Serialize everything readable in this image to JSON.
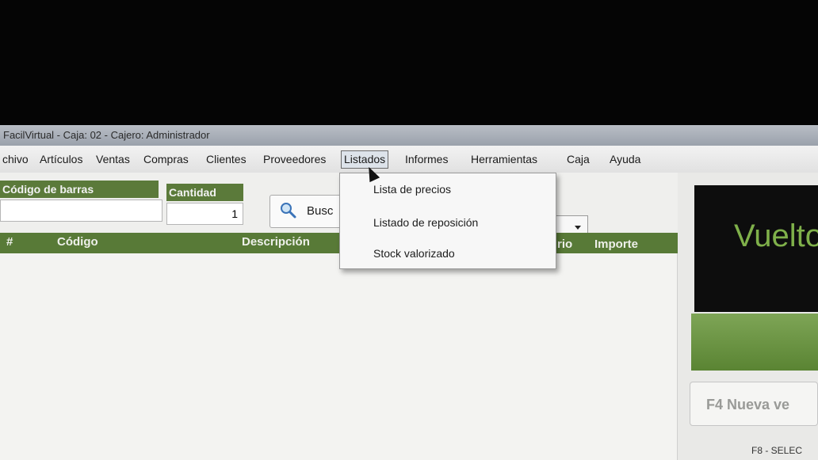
{
  "window": {
    "title": "FacilVirtual - Caja: 02 - Cajero: Administrador"
  },
  "menubar": {
    "items": [
      {
        "label": "chivo"
      },
      {
        "label": "Artículos"
      },
      {
        "label": "Ventas"
      },
      {
        "label": "Compras"
      },
      {
        "label": "Clientes"
      },
      {
        "label": "Proveedores"
      },
      {
        "label": "Listados"
      },
      {
        "label": "Informes"
      },
      {
        "label": "Herramientas"
      },
      {
        "label": "Caja"
      },
      {
        "label": "Ayuda"
      }
    ],
    "active": "Listados"
  },
  "listados_menu": {
    "items": [
      {
        "label": "Lista de precios"
      },
      {
        "label": "Listado de reposición"
      },
      {
        "label": "Stock valorizado"
      }
    ]
  },
  "form": {
    "barcode_label": "Código de barras",
    "barcode_value": "",
    "quantity_label": "Cantidad",
    "quantity_value": "1",
    "search_text": "Busc"
  },
  "grid": {
    "columns": [
      "#",
      "Código",
      "Descripción",
      "rio",
      "Importe"
    ]
  },
  "side_panel": {
    "vuelto_text": "Vuelto",
    "f4_label": "F4 Nueva ve",
    "f8_label": "F8 - SELEC"
  },
  "colors": {
    "accent_green": "#5b7a3a",
    "vuelto_green": "#7fb04a",
    "panel_dark": "#0d0d0d"
  }
}
